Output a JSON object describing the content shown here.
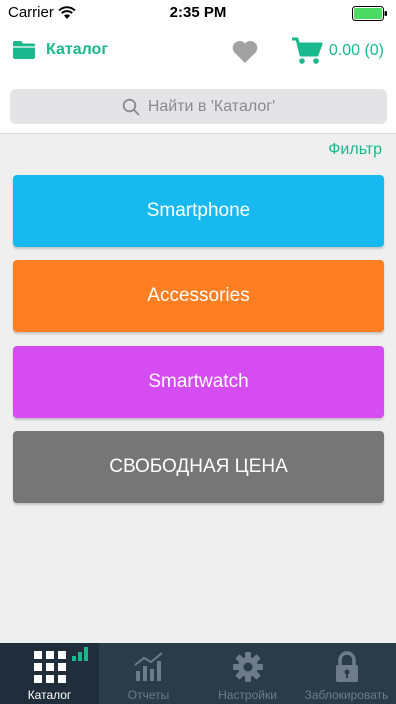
{
  "status_bar": {
    "carrier": "Carrier",
    "time": "2:35 PM",
    "battery_color": "#4cd964"
  },
  "nav": {
    "folder_icon": "folder-icon",
    "title": "Каталог",
    "heart_icon": "heart-icon",
    "cart_icon": "cart-icon",
    "cart_text": "0.00 (0)",
    "accent_color": "#19b88d"
  },
  "search": {
    "placeholder": "Найти в 'Каталог'"
  },
  "filter": {
    "label": "Фильтр"
  },
  "categories": [
    {
      "label": "Smartphone",
      "color": "#18b9ef"
    },
    {
      "label": "Accessories",
      "color": "#ff7f22"
    },
    {
      "label": "Smartwatch",
      "color": "#d54cf2"
    },
    {
      "label": "СВОБОДНАЯ ЦЕНА",
      "color": "#767676"
    }
  ],
  "tabs": [
    {
      "label": "Каталог",
      "icon": "grid-icon",
      "active": true
    },
    {
      "label": "Отчеты",
      "icon": "chart-icon",
      "active": false
    },
    {
      "label": "Настройки",
      "icon": "gear-icon",
      "active": false
    },
    {
      "label": "Заблокировать",
      "icon": "lock-icon",
      "active": false
    }
  ]
}
